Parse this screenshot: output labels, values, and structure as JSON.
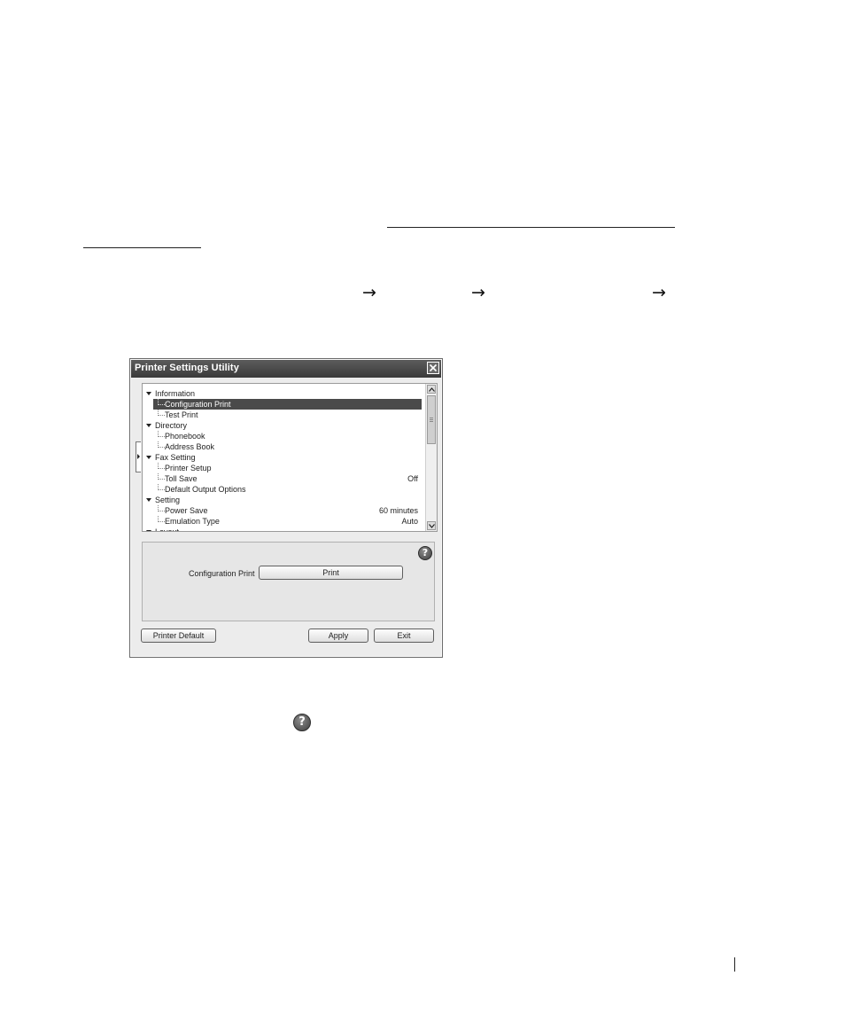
{
  "doc": {
    "arrow": "→",
    "footer_bar": "|"
  },
  "dialog": {
    "title": "Printer Settings Utility",
    "help_glyph": "?",
    "tree": [
      {
        "label": "Information",
        "value": "",
        "level": 0
      },
      {
        "label": "Configuration Print",
        "value": "",
        "level": 1,
        "selected": true
      },
      {
        "label": "Test Print",
        "value": "",
        "level": 1
      },
      {
        "label": "Directory",
        "value": "",
        "level": 0
      },
      {
        "label": "Phonebook",
        "value": "",
        "level": 1
      },
      {
        "label": "Address Book",
        "value": "",
        "level": 1
      },
      {
        "label": "Fax Setting",
        "value": "",
        "level": 0
      },
      {
        "label": "Printer Setup",
        "value": "",
        "level": 1
      },
      {
        "label": "Toll Save",
        "value": "Off",
        "level": 1
      },
      {
        "label": "Default Output Options",
        "value": "",
        "level": 1
      },
      {
        "label": "Setting",
        "value": "",
        "level": 0
      },
      {
        "label": "Power Save",
        "value": "60 minutes",
        "level": 1
      },
      {
        "label": "Emulation Type",
        "value": "Auto",
        "level": 1
      },
      {
        "label": "Layout",
        "value": "",
        "level": 0
      }
    ],
    "panel": {
      "label": "Configuration Print",
      "print_button": "Print"
    },
    "buttons": {
      "printer_default": "Printer Default",
      "apply": "Apply",
      "exit": "Exit"
    }
  }
}
